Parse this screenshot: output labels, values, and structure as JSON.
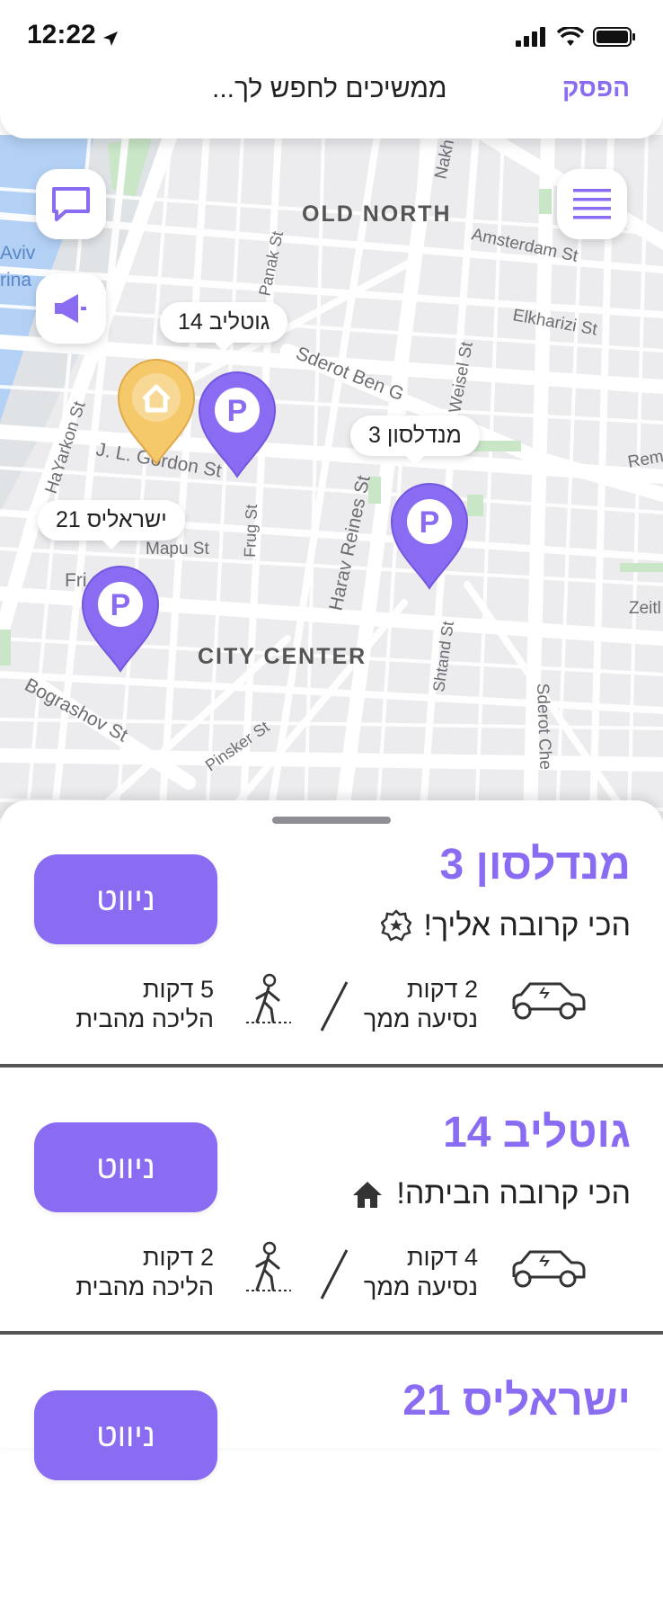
{
  "status_bar": {
    "time": "12:22"
  },
  "top_bar": {
    "stop_label": "הפסק",
    "searching_text": "ממשיכים לחפש לך..."
  },
  "map": {
    "labels": {
      "old_north": "OLD NORTH",
      "city_center": "CITY CENTER",
      "amsterdam": "Amsterdam St",
      "elkharizi": "Elkharizi St",
      "sderot_ben": "Sderot Ben G",
      "weisel": "Weisel St",
      "hayarkon": "HaYarkon St",
      "gordon": "J. L. Gordon St",
      "mapu": "Mapu St",
      "frug": "Frug St",
      "harav_reines": "Harav Reines St",
      "frishman": "Fri        n St",
      "bograshov": "Bograshov St",
      "pinsker": "Pinsker St",
      "shtand": "Shtand St",
      "sderot_che": "Sderot Che",
      "zeitl": "Zeitl",
      "remi": "Rem",
      "panak": "Panak St",
      "nakh": "Nakh",
      "aviv": "Aviv",
      "rina": "rina"
    },
    "bubbles": {
      "gotliv": "גוטליב 14",
      "mendelson": "מנדלסון 3",
      "israelis": "ישראליס 21"
    },
    "pin_letter": "P"
  },
  "colors": {
    "accent": "#8a6cf2",
    "home_pin": "#f5c96a"
  },
  "results": [
    {
      "title": "מנדלסון 3",
      "subtitle": "הכי קרובה אליך!",
      "subtitle_icon": "badge-star-icon",
      "nav_label": "ניווט",
      "drive_time": "2 דקות",
      "drive_label": "נסיעה ממך",
      "walk_time": "5 דקות",
      "walk_label": "הליכה מהבית"
    },
    {
      "title": "גוטליב 14",
      "subtitle": "הכי קרובה הביתה!",
      "subtitle_icon": "home-icon",
      "nav_label": "ניווט",
      "drive_time": "4 דקות",
      "drive_label": "נסיעה ממך",
      "walk_time": "2 דקות",
      "walk_label": "הליכה מהבית"
    },
    {
      "title": "ישראליס 21",
      "nav_label": "ניווט"
    }
  ]
}
